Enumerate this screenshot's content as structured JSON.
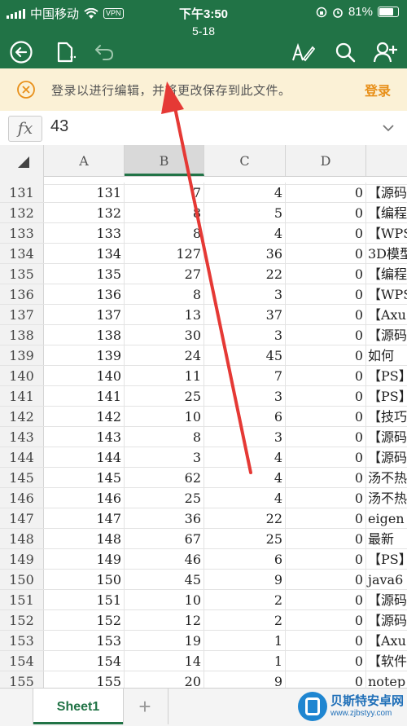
{
  "status_bar": {
    "carrier": "中国移动",
    "vpn": "VPN",
    "time": "下午3:50",
    "battery": "81%"
  },
  "toolbar": {
    "file_name": "5-18",
    "icons": [
      "back-circle-icon",
      "file-share-icon",
      "undo-icon",
      "edit-pen-icon",
      "search-icon",
      "add-person-icon"
    ]
  },
  "banner": {
    "message": "登录以进行编辑，并将更改保存到此文件。",
    "login_label": "登录"
  },
  "formula_bar": {
    "fx_label": "fx",
    "value": "43"
  },
  "grid": {
    "columns": [
      "A",
      "B",
      "C",
      "D"
    ],
    "selected_column": "B",
    "rows": [
      {
        "row": "131",
        "a": "131",
        "b": "7",
        "c": "4",
        "d": "0",
        "e": "【源码"
      },
      {
        "row": "132",
        "a": "132",
        "b": "8",
        "c": "5",
        "d": "0",
        "e": "【编程"
      },
      {
        "row": "133",
        "a": "133",
        "b": "8",
        "c": "4",
        "d": "0",
        "e": "【WPS"
      },
      {
        "row": "134",
        "a": "134",
        "b": "127",
        "c": "36",
        "d": "0",
        "e": "3D模型"
      },
      {
        "row": "135",
        "a": "135",
        "b": "27",
        "c": "22",
        "d": "0",
        "e": "【编程"
      },
      {
        "row": "136",
        "a": "136",
        "b": "8",
        "c": "3",
        "d": "0",
        "e": "【WPS"
      },
      {
        "row": "137",
        "a": "137",
        "b": "13",
        "c": "37",
        "d": "0",
        "e": "【Axu"
      },
      {
        "row": "138",
        "a": "138",
        "b": "30",
        "c": "3",
        "d": "0",
        "e": "【源码"
      },
      {
        "row": "139",
        "a": "139",
        "b": "24",
        "c": "45",
        "d": "0",
        "e": "如何"
      },
      {
        "row": "140",
        "a": "140",
        "b": "11",
        "c": "7",
        "d": "0",
        "e": "【PS】"
      },
      {
        "row": "141",
        "a": "141",
        "b": "25",
        "c": "3",
        "d": "0",
        "e": "【PS】"
      },
      {
        "row": "142",
        "a": "142",
        "b": "10",
        "c": "6",
        "d": "0",
        "e": "【技巧"
      },
      {
        "row": "143",
        "a": "143",
        "b": "8",
        "c": "3",
        "d": "0",
        "e": "【源码"
      },
      {
        "row": "144",
        "a": "144",
        "b": "3",
        "c": "4",
        "d": "0",
        "e": "【源码"
      },
      {
        "row": "145",
        "a": "145",
        "b": "62",
        "c": "4",
        "d": "0",
        "e": "汤不热"
      },
      {
        "row": "146",
        "a": "146",
        "b": "25",
        "c": "4",
        "d": "0",
        "e": "汤不热"
      },
      {
        "row": "147",
        "a": "147",
        "b": "36",
        "c": "22",
        "d": "0",
        "e": "eigen"
      },
      {
        "row": "148",
        "a": "148",
        "b": "67",
        "c": "25",
        "d": "0",
        "e": "最新"
      },
      {
        "row": "149",
        "a": "149",
        "b": "46",
        "c": "6",
        "d": "0",
        "e": "【PS】"
      },
      {
        "row": "150",
        "a": "150",
        "b": "45",
        "c": "9",
        "d": "0",
        "e": "java6"
      },
      {
        "row": "151",
        "a": "151",
        "b": "10",
        "c": "2",
        "d": "0",
        "e": "【源码"
      },
      {
        "row": "152",
        "a": "152",
        "b": "12",
        "c": "2",
        "d": "0",
        "e": "【源码"
      },
      {
        "row": "153",
        "a": "153",
        "b": "19",
        "c": "1",
        "d": "0",
        "e": "【Axu"
      },
      {
        "row": "154",
        "a": "154",
        "b": "14",
        "c": "1",
        "d": "0",
        "e": "【软件"
      },
      {
        "row": "155",
        "a": "155",
        "b": "20",
        "c": "9",
        "d": "0",
        "e": "notep"
      }
    ]
  },
  "sheet_tabs": {
    "active": "Sheet1",
    "add_label": "+"
  },
  "watermark": {
    "line1": "贝斯特安卓网",
    "line2": "www.zjbstyy.com"
  },
  "colors": {
    "accent": "#217346",
    "banner_bg": "#fbf1d6",
    "login": "#e8901a",
    "arrow": "#e53935"
  }
}
